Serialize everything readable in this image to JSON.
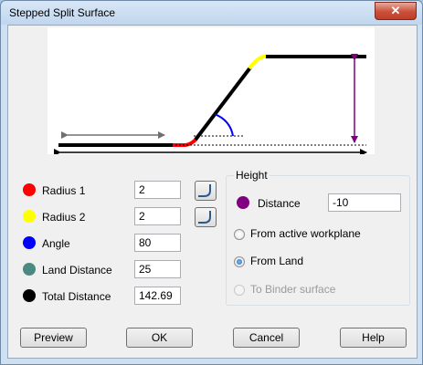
{
  "window": {
    "title": "Stepped Split Surface",
    "close_glyph": "✕"
  },
  "params": [
    {
      "label": "Radius 1",
      "value": "2",
      "color": "#ff0000"
    },
    {
      "label": "Radius 2",
      "value": "2",
      "color": "#ffff00"
    },
    {
      "label": "Angle",
      "value": "80",
      "color": "#0000ff"
    },
    {
      "label": "Land Distance",
      "value": "25",
      "color": "#4a8a80"
    },
    {
      "label": "Total Distance",
      "value": "142.69",
      "color": "#000000"
    }
  ],
  "height": {
    "group_title": "Height",
    "distance_label": "Distance",
    "distance_value": "-10",
    "distance_color": "#800080",
    "options": [
      {
        "label": "From active workplane",
        "selected": false,
        "enabled": true
      },
      {
        "label": "From Land",
        "selected": true,
        "enabled": true
      },
      {
        "label": "To Binder surface",
        "selected": false,
        "enabled": false
      }
    ]
  },
  "buttons": {
    "preview": "Preview",
    "ok": "OK",
    "cancel": "Cancel",
    "help": "Help"
  },
  "icons": {
    "fillet_1": "fillet-icon",
    "fillet_2": "fillet-icon",
    "close": "close-icon"
  }
}
